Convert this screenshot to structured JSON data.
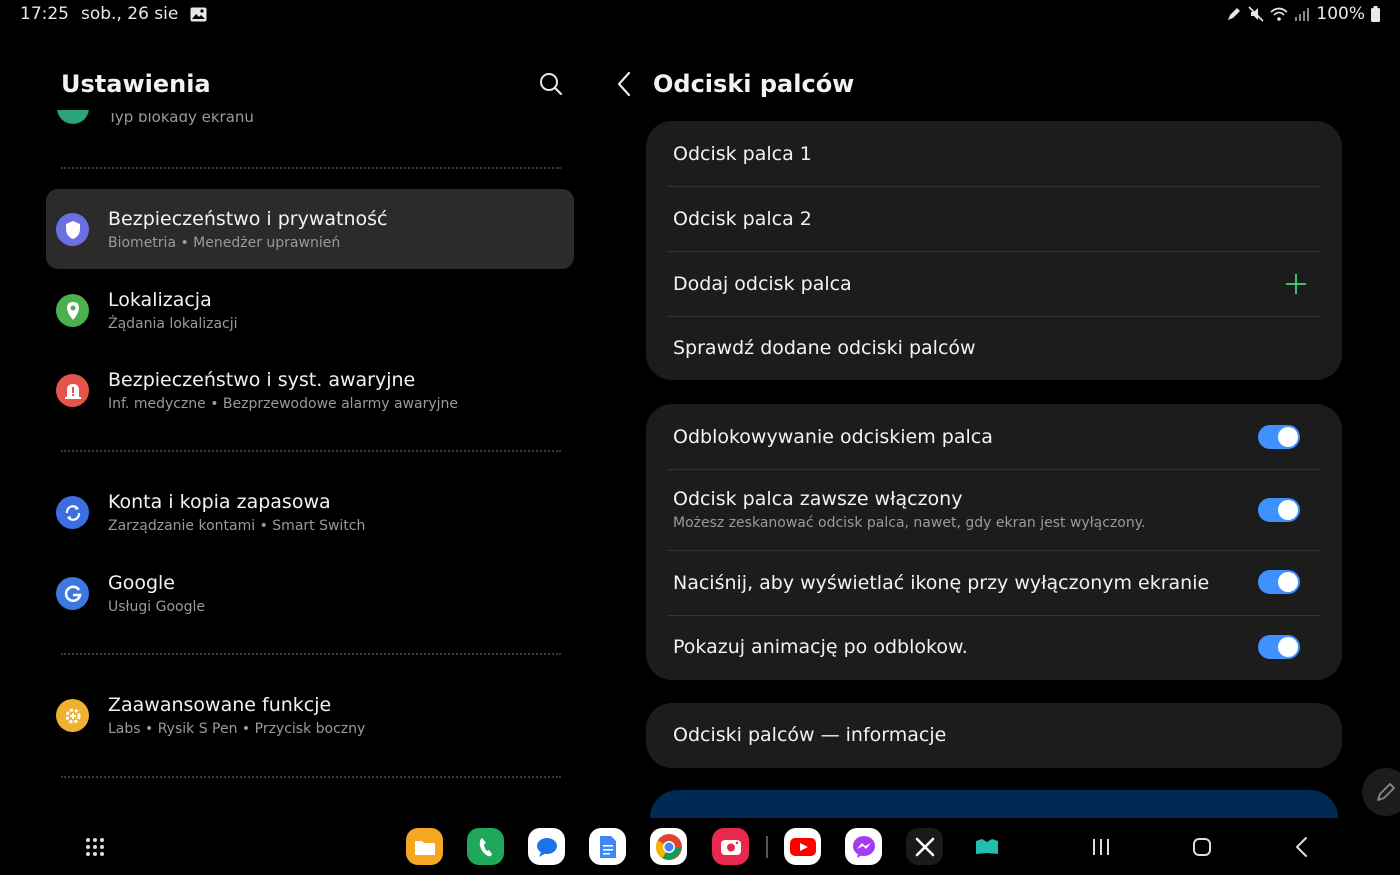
{
  "status_bar": {
    "time": "17:25",
    "date": "sob., 26 sie",
    "battery": "100%"
  },
  "left_panel": {
    "title": "Ustawienia",
    "partial_item_sub": "Typ blokady ekranu",
    "items": [
      {
        "title": "Bezpieczeństwo i prywatność",
        "sub": "Biometria  •  Menedżer uprawnień",
        "icon": "shield-icon",
        "color": "#6b6fe0"
      },
      {
        "title": "Lokalizacja",
        "sub": "Żądania lokalizacji",
        "icon": "location-pin-icon",
        "color": "#4caf50"
      },
      {
        "title": "Bezpieczeństwo i syst. awaryjne",
        "sub": "Inf. medyczne  •  Bezprzewodowe alarmy awaryjne",
        "icon": "emergency-icon",
        "color": "#e5534b"
      },
      {
        "title": "Konta i kopia zapasowa",
        "sub": "Zarządzanie kontami  •  Smart Switch",
        "icon": "sync-icon",
        "color": "#3c6ee0"
      },
      {
        "title": "Google",
        "sub": "Usługi Google",
        "icon": "google-icon",
        "color": "#3c78e0"
      },
      {
        "title": "Zaawansowane funkcje",
        "sub": "Labs  •  Rysik S Pen  •  Przycisk boczny",
        "icon": "gear-plus-icon",
        "color": "#f0b030"
      }
    ]
  },
  "right_panel": {
    "title": "Odciski palców",
    "card1": {
      "rows": [
        "Odcisk palca 1",
        "Odcisk palca 2",
        "Dodaj odcisk palca",
        "Sprawdź dodane odciski palców"
      ]
    },
    "card2": {
      "rows": [
        {
          "title": "Odblokowywanie odciskiem palca",
          "sub": "",
          "on": true
        },
        {
          "title": "Odcisk palca zawsze włączony",
          "sub": "Możesz zeskanować odcisk palca, nawet, gdy ekran jest wyłączony.",
          "on": true
        },
        {
          "title": "Naciśnij, aby wyświetlać ikonę przy wyłączonym ekranie",
          "sub": "",
          "on": true
        },
        {
          "title": "Pokazuj animację po odblokow.",
          "sub": "",
          "on": true
        }
      ]
    },
    "card3": {
      "title": "Odciski palców — informacje"
    }
  },
  "colors": {
    "accent_toggle": "#3e91ff",
    "plus_green": "#3fbf6a",
    "card_bg": "#1c1c1c"
  },
  "dock": {
    "apps": [
      {
        "name": "files-app-icon",
        "color": "#f5a623"
      },
      {
        "name": "phone-app-icon",
        "color": "#1fa85b"
      },
      {
        "name": "messages-app-icon",
        "color": "#ffffff"
      },
      {
        "name": "docs-app-icon",
        "color": "#ffffff"
      },
      {
        "name": "chrome-app-icon",
        "color": "#ffffff"
      },
      {
        "name": "screen-recorder-app-icon",
        "color": "#e8294d"
      },
      {
        "name": "youtube-app-icon",
        "color": "#ffffff"
      },
      {
        "name": "messenger-app-icon",
        "color": "#ffffff"
      },
      {
        "name": "x-app-icon",
        "color": "#1a1a1a"
      },
      {
        "name": "tablet-app-icon",
        "color": "#000000"
      }
    ]
  }
}
